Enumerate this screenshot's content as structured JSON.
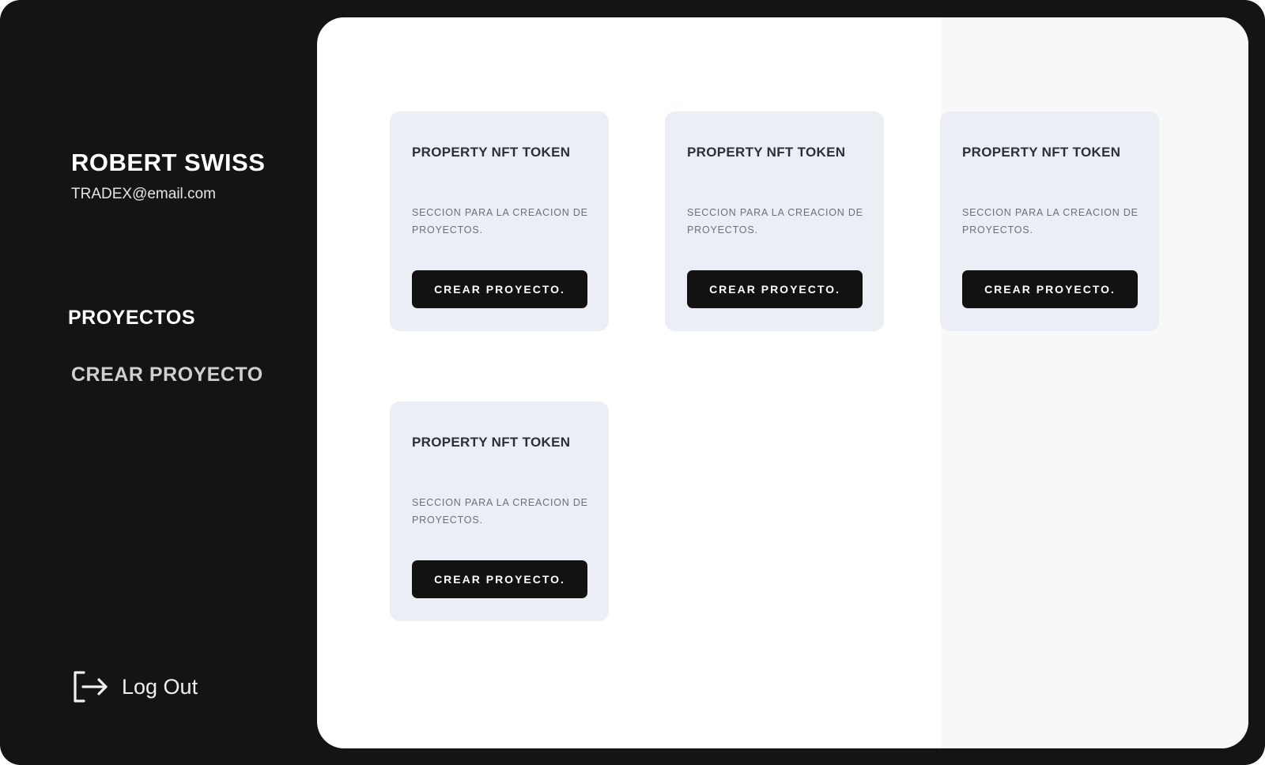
{
  "user": {
    "name": "ROBERT SWISS",
    "email": "TRADEX@email.com"
  },
  "nav": {
    "projects_label": "PROYECTOS",
    "create_project_label": "CREAR PROYECTO"
  },
  "logout": {
    "label": "Log Out",
    "icon": "logout-icon"
  },
  "cards": [
    {
      "title": "PROPERTY NFT TOKEN",
      "description": "SECCION PARA LA CREACION DE PROYECTOS.",
      "button_label": "CREAR PROYECTO."
    },
    {
      "title": "PROPERTY NFT TOKEN",
      "description": "SECCION PARA LA CREACION DE PROYECTOS.",
      "button_label": "CREAR PROYECTO."
    },
    {
      "title": "PROPERTY NFT TOKEN",
      "description": "SECCION PARA LA CREACION DE PROYECTOS.",
      "button_label": "CREAR PROYECTO."
    },
    {
      "title": "PROPERTY NFT TOKEN",
      "description": "SECCION PARA LA CREACION DE PROYECTOS.",
      "button_label": "CREAR PROYECTO."
    }
  ],
  "colors": {
    "sidebar_background": "#141414",
    "card_background": "#ebeef5",
    "button_background": "#121212",
    "main_background": "#ffffff"
  }
}
